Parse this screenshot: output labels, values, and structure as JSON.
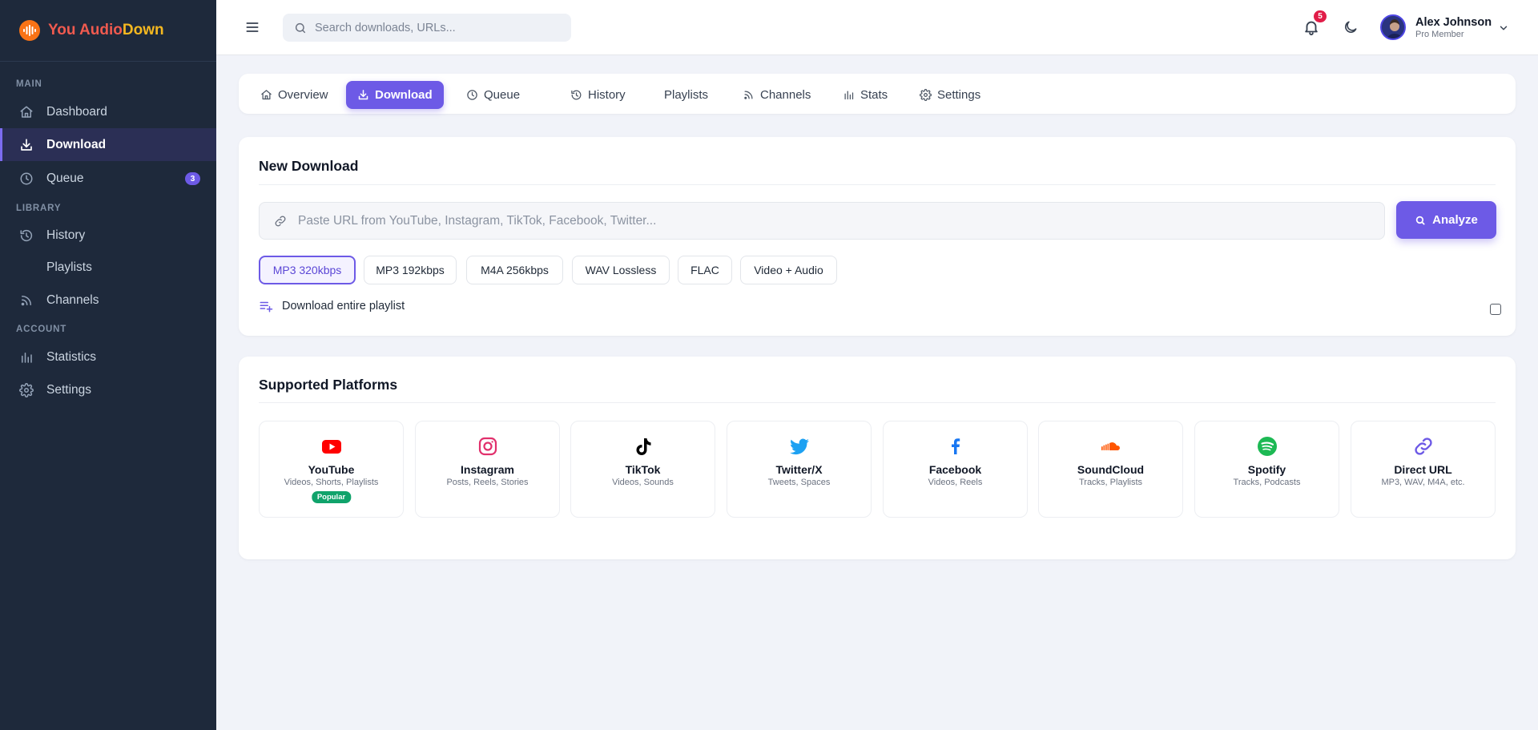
{
  "brand": {
    "name_part1": "You Audio",
    "name_part2": "Down",
    "colors": {
      "primary": "#f05a4f",
      "accent": "#f5b820"
    }
  },
  "sidebar": {
    "sections": [
      {
        "label": "MAIN"
      },
      {
        "label": "LIBRARY"
      },
      {
        "label": "ACCOUNT"
      }
    ],
    "items": [
      {
        "label": "Dashboard",
        "icon": "home-icon"
      },
      {
        "label": "Download",
        "icon": "download-icon",
        "active": true
      },
      {
        "label": "Queue",
        "icon": "clock-icon",
        "badge": "3"
      },
      {
        "label": "History",
        "icon": "history-icon"
      },
      {
        "label": "Playlists",
        "icon": "none"
      },
      {
        "label": "Channels",
        "icon": "rss-icon"
      },
      {
        "label": "Statistics",
        "icon": "bar-chart-icon"
      },
      {
        "label": "Settings",
        "icon": "gear-icon"
      }
    ]
  },
  "header": {
    "search_placeholder": "Search downloads, URLs...",
    "notifications_count": "5",
    "user": {
      "name": "Alex Johnson",
      "role": "Pro Member"
    }
  },
  "tabs": [
    {
      "label": "Overview",
      "icon": "home-icon"
    },
    {
      "label": "Download",
      "icon": "download-icon",
      "active": true
    },
    {
      "label": "Queue",
      "icon": "clock-icon"
    },
    {
      "label": "History",
      "icon": "history-icon"
    },
    {
      "label": "Playlists",
      "icon": "none"
    },
    {
      "label": "Channels",
      "icon": "rss-icon"
    },
    {
      "label": "Stats",
      "icon": "bar-chart-icon"
    },
    {
      "label": "Settings",
      "icon": "gear-icon"
    }
  ],
  "new_download": {
    "title": "New Download",
    "url_placeholder": "Paste URL from YouTube, Instagram, TikTok, Facebook, Twitter...",
    "analyze_label": "Analyze",
    "formats": [
      {
        "label": "MP3 320kbps",
        "selected": true
      },
      {
        "label": "MP3 192kbps"
      },
      {
        "label": "M4A 256kbps"
      },
      {
        "label": "WAV Lossless"
      },
      {
        "label": "FLAC"
      },
      {
        "label": "Video + Audio"
      }
    ],
    "playlist_option": {
      "label": "Download entire playlist",
      "checked": false
    }
  },
  "platforms": {
    "title": "Supported Platforms",
    "items": [
      {
        "name": "YouTube",
        "desc": "Videos, Shorts, Playlists",
        "badge": "Popular",
        "icon": "youtube-icon",
        "color": "#ff0000"
      },
      {
        "name": "Instagram",
        "desc": "Posts, Reels, Stories",
        "icon": "instagram-icon",
        "color": "#e1306c"
      },
      {
        "name": "TikTok",
        "desc": "Videos, Sounds",
        "icon": "tiktok-icon",
        "color": "#000000"
      },
      {
        "name": "Twitter/X",
        "desc": "Tweets, Spaces",
        "icon": "twitter-icon",
        "color": "#1da1f2"
      },
      {
        "name": "Facebook",
        "desc": "Videos, Reels",
        "icon": "facebook-icon",
        "color": "#1877f2"
      },
      {
        "name": "SoundCloud",
        "desc": "Tracks, Playlists",
        "icon": "soundcloud-icon",
        "color": "#ff5500"
      },
      {
        "name": "Spotify",
        "desc": "Tracks, Podcasts",
        "icon": "spotify-icon",
        "color": "#1db954"
      },
      {
        "name": "Direct URL",
        "desc": "MP3, WAV, M4A, etc.",
        "icon": "link-icon",
        "color": "#6d5ae6"
      }
    ]
  }
}
